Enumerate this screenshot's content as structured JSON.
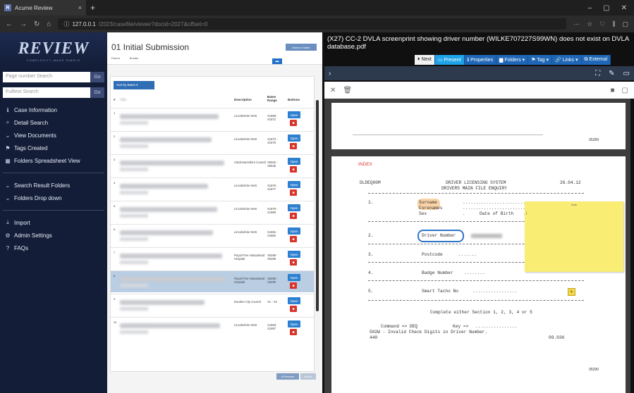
{
  "browser": {
    "tab_title": "Acume Review",
    "tab_close": "×",
    "new_tab": "+",
    "url_host": "127.0.0.1",
    "url_rest": "/2023/casefile/viewer?docid=2027&offset=0",
    "window_controls": [
      "–",
      "▢",
      "✕"
    ],
    "url_right_icons": [
      "···",
      "☆",
      "♡",
      "⫼",
      "▢"
    ]
  },
  "nav": {
    "logo": "REVIEW",
    "logo_sub": "COMPLEXITY MADE SIMPLE",
    "page_search_placeholder": "Page number Search",
    "fulltext_search_placeholder": "Fulltext Search",
    "go_label": "Go",
    "items": [
      {
        "icon": "ℹ",
        "label": "Case Information"
      },
      {
        "icon": "⌕",
        "label": "Detail Search"
      },
      {
        "icon": "⌄",
        "label": "View Documents"
      },
      {
        "icon": "⚑",
        "label": "Tags Created"
      },
      {
        "icon": "▦",
        "label": "Folders Spreadsheet View"
      }
    ],
    "items2": [
      {
        "icon": "⌄",
        "label": "Search Result Folders"
      },
      {
        "icon": "⌄",
        "label": "Folders Drop down"
      }
    ],
    "items3": [
      {
        "icon": "⤓",
        "label": "Import"
      },
      {
        "icon": "⚙",
        "label": "Admin Settings"
      },
      {
        "icon": "?",
        "label": "FAQs"
      }
    ]
  },
  "list": {
    "title": "01 Initial Submission",
    "send_button": "Move to folder",
    "parent_label": "Parent",
    "parent_value": "Bundle",
    "sort_button": "Sort by Bates ▾",
    "columns": [
      "#",
      "Title",
      "Description",
      "Bates Range",
      "Buttons"
    ],
    "open_label": "Open",
    "rows": [
      {
        "num": "1",
        "desc": "Lincolnshire NHS",
        "bates": "X1858 - X1872",
        "w": 140
      },
      {
        "num": "2",
        "desc": "Lincolnshire NHS",
        "bates": "X1873 - X1875",
        "w": 130
      },
      {
        "num": "3",
        "desc": "Clackmannshire Council",
        "bates": "X5502 - X5535",
        "w": 148
      },
      {
        "num": "4",
        "desc": "Lincolnshire NHS",
        "bates": "X1876 - X1877",
        "w": 125
      },
      {
        "num": "5",
        "desc": "Lincolnshire NHS",
        "bates": "X1878 - X1880",
        "w": 138
      },
      {
        "num": "6",
        "desc": "Lincolnshire NHS",
        "bates": "X1881 - X1882",
        "w": 132
      },
      {
        "num": "7",
        "desc": "Royal Free Hampstead Hospital",
        "bates": "X5268 - X5285",
        "w": 145
      },
      {
        "num": "8",
        "desc": "Royal Free Hampstead Hospital",
        "bates": "X5286 - X5290",
        "w": 150
      },
      {
        "num": "9",
        "desc": "Dundee City Council",
        "bates": "X1 - X2",
        "w": 120
      },
      {
        "num": "10",
        "desc": "Lincolnshire NHS",
        "bates": "X1883 - X1887",
        "w": 142
      }
    ],
    "prev_label": "◂ Previous",
    "next_label": "Next ▸"
  },
  "viewer": {
    "title": "(X27) CC-2 DVLA screenprint showing driver number (WILKE707227S99WN) does not exist on DVLA database.pdf",
    "toolbar": [
      "⏵ Next",
      "▭ Present",
      "ℹ Properties",
      "▆ Folders ▾",
      "⚑ Tag ▾",
      "🔗 Links ▾",
      "⧉ External"
    ],
    "page1_number": "05289",
    "page2_number": "05290",
    "index_label": "INDEX",
    "screen": {
      "code": "DLDEQ00M",
      "system": "DRIVER LICENSING SYSTEM",
      "subsystem": "DRIVERS MAIN FILE ENQUIRY",
      "date": "26.04.12",
      "s1": "1.",
      "surname": "Surname",
      "forenames": "Forenames",
      "sex": "Sex",
      "dob": "Date of Birth",
      "s2": "2.",
      "driver_number": "Driver Number",
      "s3": "3.",
      "postcode": "Postcode",
      "s4": "4.",
      "badge": "Badge Number",
      "s5": "5.",
      "tacho": "Smart Tacho No",
      "complete": "Complete either Section 1, 2, 3, 4 or 5",
      "command": "Command => DEQ",
      "key": "Key =>",
      "error": "502W - Invalid Check Digits in Driver Number.",
      "code440": "440",
      "time": "09.036"
    },
    "sticky_header": "Note",
    "sticky_text": "|"
  }
}
